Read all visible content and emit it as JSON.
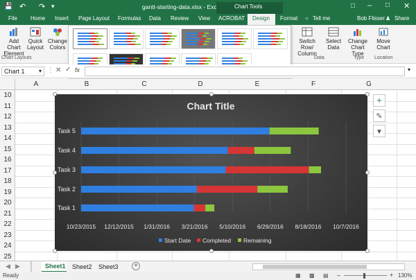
{
  "window": {
    "title": "gantt-starting-data.xlsx - Excel",
    "context": "Chart Tools"
  },
  "tabs": {
    "file": "File",
    "home": "Home",
    "insert": "Insert",
    "page_layout": "Page Layout",
    "formulas": "Formulas",
    "data": "Data",
    "review": "Review",
    "view": "View",
    "acrobat": "ACROBAT",
    "design": "Design",
    "format": "Format",
    "tell_me": "Tell me",
    "user": "Bob Flisser",
    "share": "Share"
  },
  "ribbon": {
    "add_chart_element": "Add Chart Element",
    "quick_layout": "Quick Layout",
    "change_colors": "Change Colors",
    "chart_layouts_label": "Chart Layouts",
    "switch_row_col": "Switch Row/ Column",
    "select_data": "Select Data",
    "data_label": "Data",
    "change_chart_type": "Change Chart Type",
    "type_label": "Type",
    "move_chart": "Move Chart",
    "location_label": "Location"
  },
  "formula_bar": {
    "name_box": "Chart 1"
  },
  "columns": [
    "A",
    "B",
    "C",
    "D",
    "E",
    "F",
    "G"
  ],
  "rows": [
    "10",
    "11",
    "12",
    "13",
    "14",
    "15",
    "16",
    "17",
    "18",
    "19",
    "20",
    "21",
    "22",
    "23",
    "24",
    "25"
  ],
  "sheets": [
    "Sheet1",
    "Sheet2",
    "Sheet3"
  ],
  "status": {
    "ready": "Ready",
    "zoom": "130%"
  },
  "colors": {
    "excel_green": "#217346",
    "start": "#2f7fe0",
    "completed": "#d63535",
    "remaining": "#8cc63f"
  },
  "chart_data": {
    "type": "bar",
    "orientation": "horizontal",
    "stacked": true,
    "title": "Chart Title",
    "categories": [
      "Task 5",
      "Task 4",
      "Task 3",
      "Task 2",
      "Task 1"
    ],
    "x_ticks": [
      "10/23/2015",
      "12/12/2015",
      "1/31/2016",
      "3/21/2016",
      "5/10/2016",
      "6/29/2016",
      "8/18/2016",
      "10/7/2016"
    ],
    "x_min": "2015-10-23",
    "x_max": "2016-10-07",
    "series": [
      {
        "name": "Start Date",
        "values": [
          "2016-06-28",
          "2016-05-04",
          "2016-05-01",
          "2016-03-24",
          "2016-03-20"
        ]
      },
      {
        "name": "Completed",
        "values": [
          0,
          35,
          110,
          80,
          15
        ]
      },
      {
        "name": "Remaining",
        "values": [
          65,
          48,
          16,
          40,
          12
        ]
      }
    ],
    "legend_position": "bottom",
    "grid": true
  }
}
